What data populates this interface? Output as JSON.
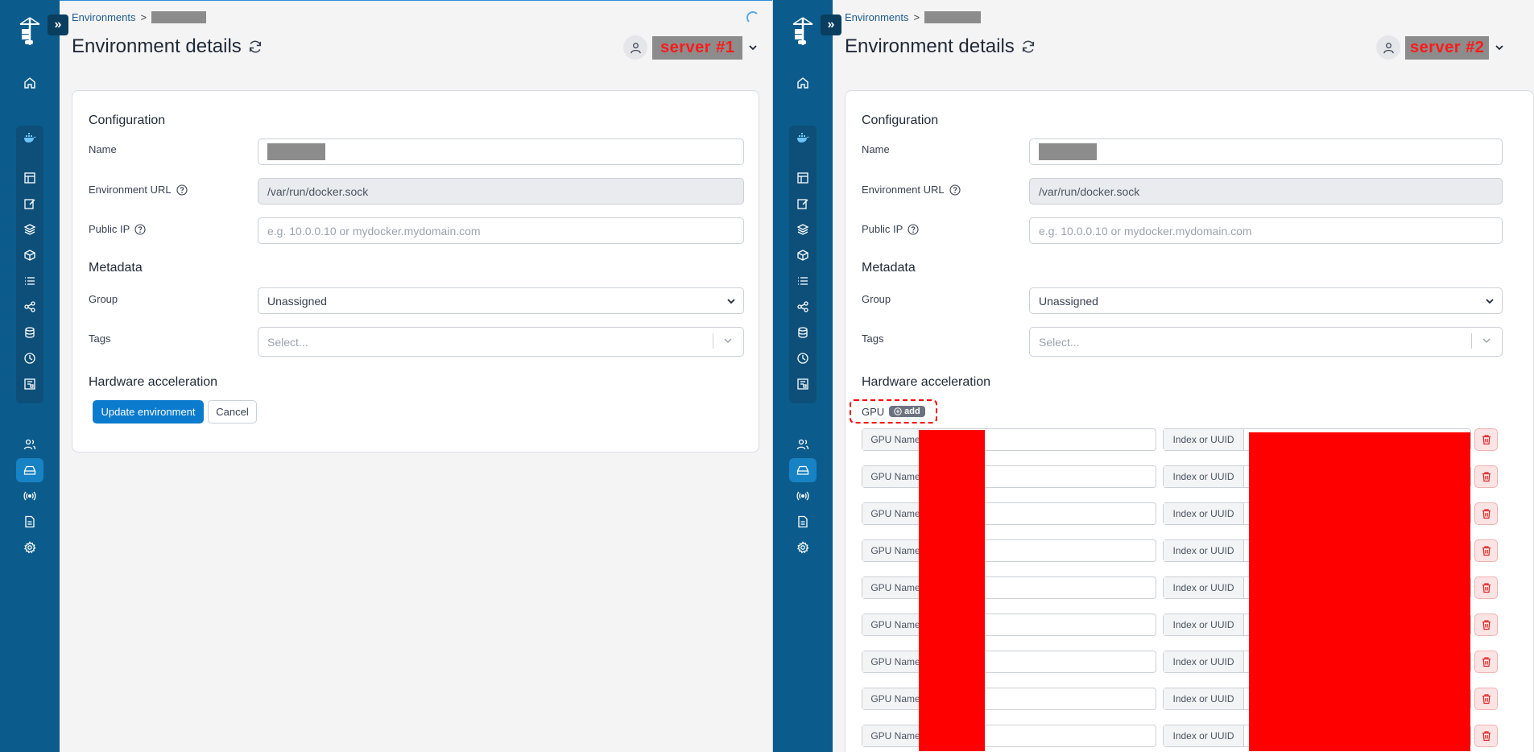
{
  "breadcrumb": {
    "root": "Environments",
    "separator": ">"
  },
  "page": {
    "title": "Environment details"
  },
  "panels": [
    {
      "server_label": "server #1"
    },
    {
      "server_label": "server #2"
    }
  ],
  "form": {
    "configuration_title": "Configuration",
    "name_label": "Name",
    "url_label": "Environment URL",
    "url_value": "/var/run/docker.sock",
    "public_ip_label": "Public IP",
    "public_ip_placeholder": "e.g. 10.0.0.10 or mydocker.mydomain.com",
    "metadata_title": "Metadata",
    "group_label": "Group",
    "group_value": "Unassigned",
    "tags_label": "Tags",
    "tags_placeholder": "Select...",
    "hardware_title": "Hardware acceleration",
    "update_button": "Update environment",
    "cancel_button": "Cancel"
  },
  "gpu": {
    "label": "GPU",
    "add_label": "add",
    "name_addon": "GPU Name",
    "id_addon": "Index or UUID",
    "row_count": 9
  },
  "colors": {
    "sidebar": "#0b5c8c",
    "accent": "#0b7bce",
    "redaction": "#ff0000",
    "server_label_text": "#ff1a1a"
  },
  "icons": {
    "sidebar_top": [
      "home-icon"
    ],
    "sidebar_env": [
      "docker-icon",
      "dashboard-icon",
      "edit-icon",
      "layers-icon",
      "box-icon",
      "list-icon",
      "share-icon",
      "database-icon",
      "clock-icon",
      "registry-icon"
    ],
    "sidebar_bottom": [
      "users-icon",
      "environments-icon",
      "broadcast-icon",
      "document-icon",
      "gear-icon"
    ]
  }
}
